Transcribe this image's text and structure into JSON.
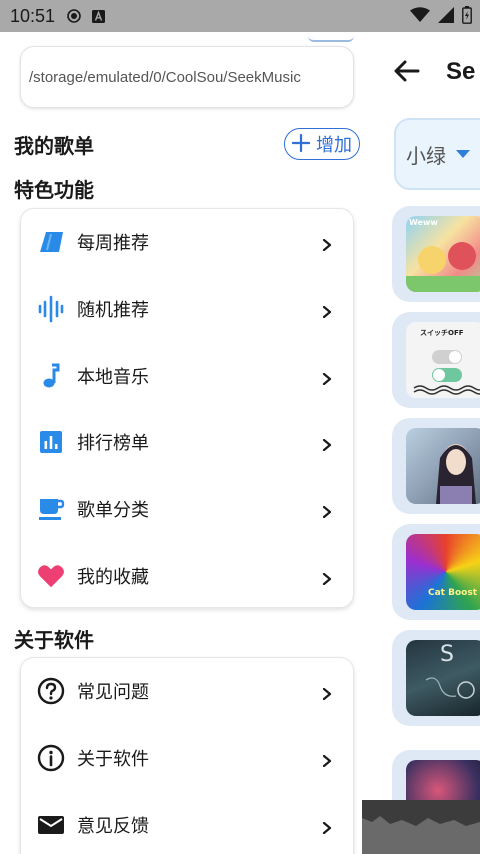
{
  "status_bar": {
    "time": "10:51"
  },
  "right_page": {
    "title": "Se",
    "voice_select": "小绿",
    "covers": [
      {
        "text": "Weww"
      },
      {
        "text": "スイッチOFF"
      },
      {
        "text": ""
      },
      {
        "text": "Cat Boost"
      },
      {
        "text": "S"
      },
      {
        "text": ""
      }
    ]
  },
  "drawer": {
    "path": "/storage/emulated/0/CoolSou/SeekMusic",
    "my_playlists_title": "我的歌单",
    "add_label": "增加",
    "features_title": "特色功能",
    "features": [
      {
        "label": "每周推荐",
        "icon": "tag-icon"
      },
      {
        "label": "随机推荐",
        "icon": "waveform-icon"
      },
      {
        "label": "本地音乐",
        "icon": "music-note-icon"
      },
      {
        "label": "排行榜单",
        "icon": "bar-chart-icon"
      },
      {
        "label": "歌单分类",
        "icon": "cup-icon"
      },
      {
        "label": "我的收藏",
        "icon": "heart-icon"
      }
    ],
    "about_title": "关于软件",
    "about_items": [
      {
        "label": "常见问题",
        "icon": "help-circle-icon"
      },
      {
        "label": "关于软件",
        "icon": "info-circle-icon"
      },
      {
        "label": "意见反馈",
        "icon": "mail-icon"
      }
    ]
  },
  "colors": {
    "accent_blue": "#2f6fd6",
    "icon_blue": "#2a8ae8",
    "heart_pink": "#ee3f73",
    "status_bar": "#a9a9a9"
  }
}
